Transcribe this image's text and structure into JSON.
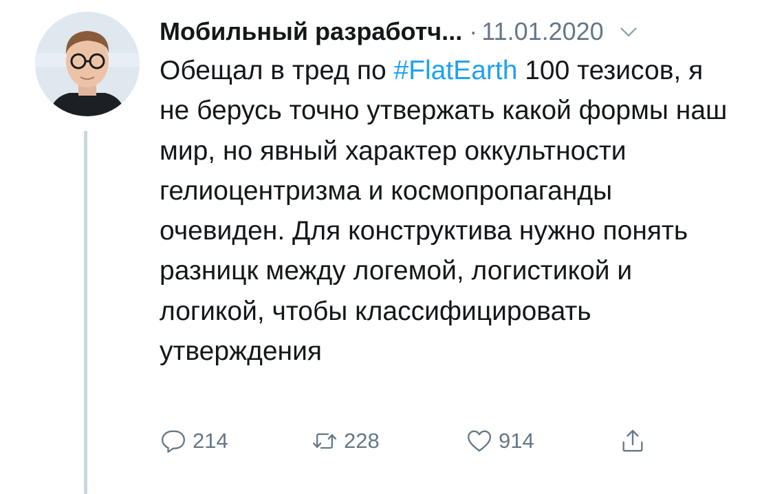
{
  "tweet": {
    "author_name": "Мобильный разработч...",
    "separator": "·",
    "date": "11.01.2020",
    "text_before": "Обещал в тред по ",
    "hashtag": "#FlatEarth",
    "text_after": " 100 тезисов, я не берусь точно утвержать какой формы наш мир, но явный характер оккультности гелиоцентризма и космопропаганды очевиден. Для конструктива нужно понять разницк между логемой, логистикой и логикой, чтобы классифицировать утверждения",
    "actions": {
      "reply": {
        "icon": "reply-icon",
        "count": "214"
      },
      "retweet": {
        "icon": "retweet-icon",
        "count": "228"
      },
      "like": {
        "icon": "heart-icon",
        "count": "914"
      },
      "share": {
        "icon": "share-icon"
      }
    }
  },
  "colors": {
    "text": "#14171a",
    "secondary": "#657786",
    "hashtag": "#1da1f2",
    "thread_line": "#ccd6dd"
  }
}
